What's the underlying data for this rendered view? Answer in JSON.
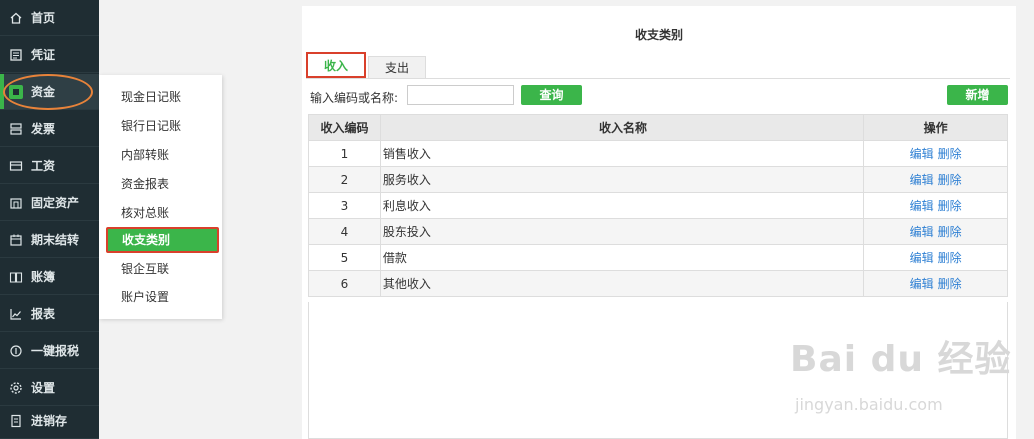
{
  "sidebar": {
    "items": [
      {
        "label": "首页",
        "icon": "home-icon"
      },
      {
        "label": "凭证",
        "icon": "voucher-icon"
      },
      {
        "label": "资金",
        "icon": "funds-icon"
      },
      {
        "label": "发票",
        "icon": "invoice-icon"
      },
      {
        "label": "工资",
        "icon": "salary-icon"
      },
      {
        "label": "固定资产",
        "icon": "fixed-assets-icon"
      },
      {
        "label": "期末结转",
        "icon": "calendar-icon"
      },
      {
        "label": "账簿",
        "icon": "ledger-book-icon"
      },
      {
        "label": "报表",
        "icon": "chart-icon"
      },
      {
        "label": "一键报税",
        "icon": "tax-icon"
      },
      {
        "label": "设置",
        "icon": "gear-icon"
      },
      {
        "label": "进销存",
        "icon": "inventory-icon"
      }
    ],
    "active_index": 2
  },
  "submenu": {
    "items": [
      "现金日记账",
      "银行日记账",
      "内部转账",
      "资金报表",
      "核对总账",
      "收支类别",
      "银企互联",
      "账户设置"
    ],
    "active_index": 5
  },
  "main": {
    "title": "收支类别",
    "tabs": [
      "收入",
      "支出"
    ],
    "search_label": "输入编码或名称:",
    "search_value": "",
    "query_button": "查询",
    "add_button": "新增",
    "table": {
      "headers": [
        "收入编码",
        "收入名称",
        "操作"
      ],
      "rows": [
        {
          "code": "1",
          "name": "销售收入"
        },
        {
          "code": "2",
          "name": "服务收入"
        },
        {
          "code": "3",
          "name": "利息收入"
        },
        {
          "code": "4",
          "name": "股东投入"
        },
        {
          "code": "5",
          "name": "借款"
        },
        {
          "code": "6",
          "name": "其他收入"
        }
      ],
      "edit_label": "编辑",
      "delete_label": "删除"
    }
  },
  "watermark": {
    "logo": "Bai du 经验",
    "url": "jingyan.baidu.com"
  },
  "colors": {
    "accent": "#3bb54a",
    "sidebar_bg": "#1f2d33",
    "highlight_border": "#d9402b",
    "ring": "#e8833a",
    "link": "#2d7fd3"
  }
}
